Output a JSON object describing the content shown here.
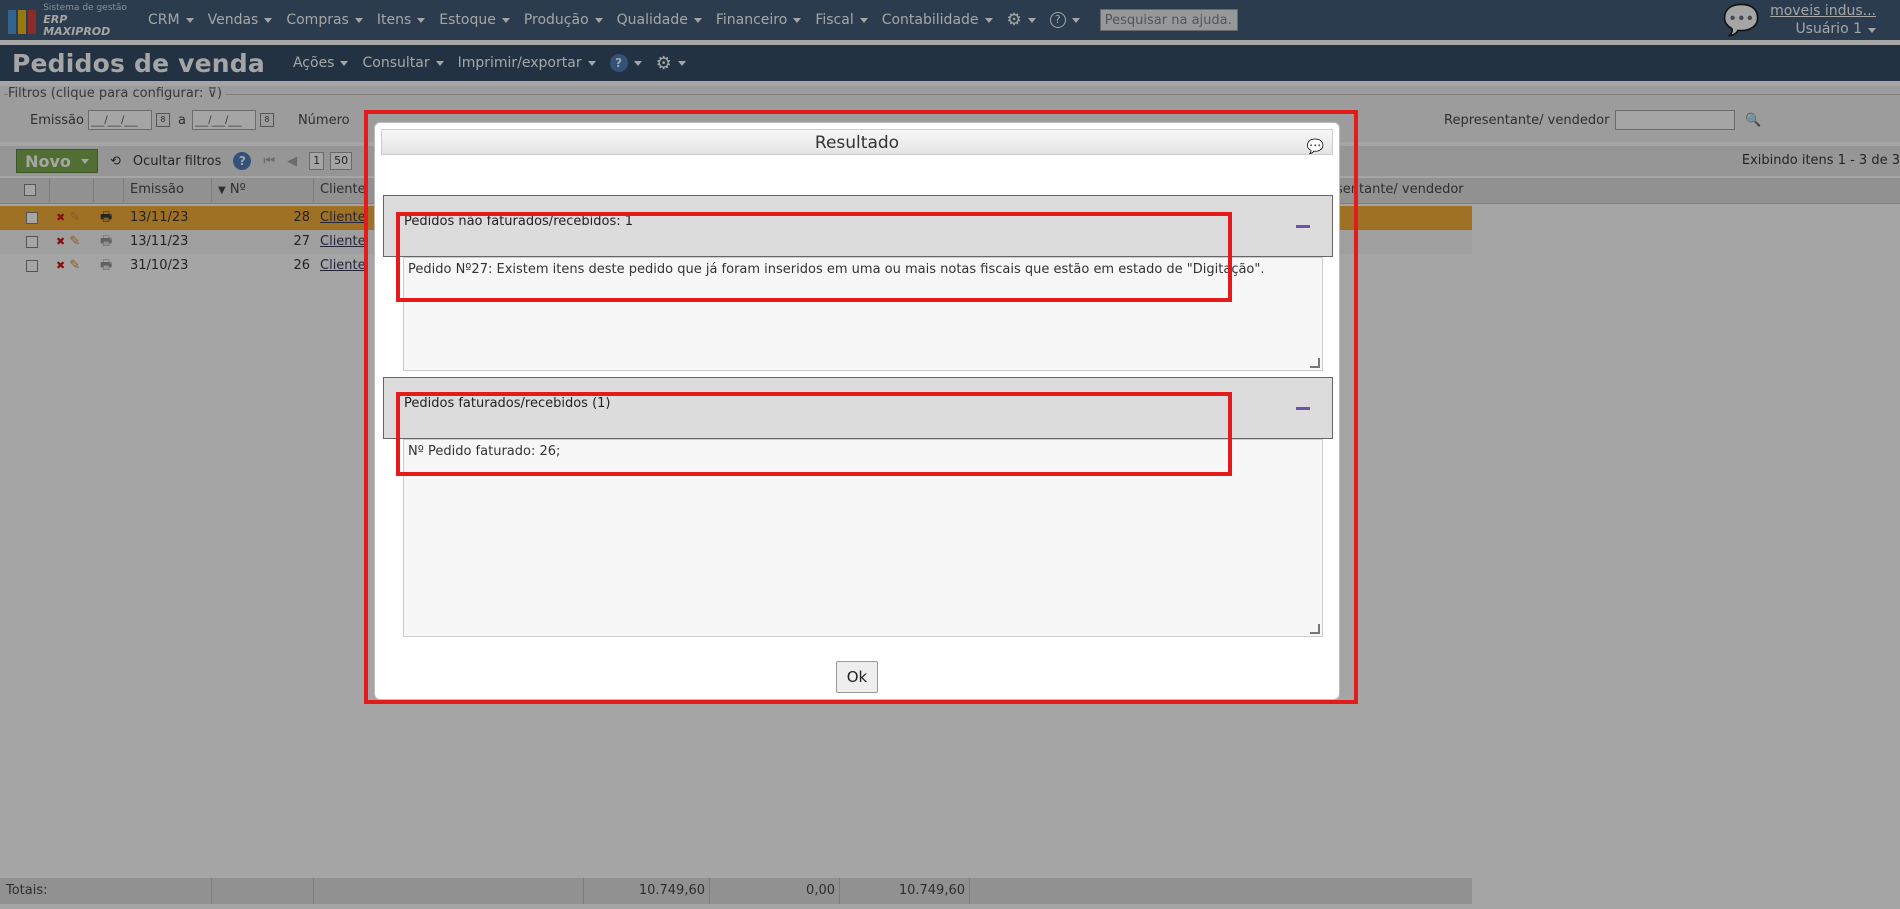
{
  "app": {
    "logo_line1": "Sistema de gestão",
    "logo_line2": "ERP MAXIPROD"
  },
  "topnav": {
    "menus": [
      "CRM",
      "Vendas",
      "Compras",
      "Itens",
      "Estoque",
      "Produção",
      "Qualidade",
      "Financeiro",
      "Fiscal",
      "Contabilidade"
    ],
    "help_search_placeholder": "Pesquisar na ajuda...",
    "company": "moveis indus...",
    "user": "Usuário 1"
  },
  "page": {
    "title": "Pedidos de venda",
    "menus": [
      "Ações",
      "Consultar",
      "Imprimir/exportar"
    ]
  },
  "filters": {
    "legend": "Filtros (clique para configurar:",
    "emissao_label": "Emissão",
    "date_from": "__/__/__",
    "date_sep": "a",
    "date_to": "__/__/__",
    "numero_label": "Número",
    "representante_label": "Representante/ vendedor"
  },
  "toolbar": {
    "novo_label": "Novo",
    "ocultar_filtros": "Ocultar filtros",
    "page_number": "1",
    "page_size": "50",
    "display_info": "Exibindo itens 1 - 3 de 3"
  },
  "grid": {
    "headers": {
      "emissao": "Emissão",
      "numero": "Nº",
      "cliente": "Cliente",
      "representante": "sentante/ vendedor"
    },
    "rows": [
      {
        "emissao": "13/11/23",
        "numero": "28",
        "cliente": "Cliente"
      },
      {
        "emissao": "13/11/23",
        "numero": "27",
        "cliente": "Cliente"
      },
      {
        "emissao": "31/10/23",
        "numero": "26",
        "cliente": "Cliente"
      }
    ],
    "totals": {
      "label": "Totais:",
      "v1": "10.749,60",
      "v2": "0,00",
      "v3": "10.749,60"
    }
  },
  "modal": {
    "title": "Resultado",
    "section1": {
      "title": "Pedidos não faturados/recebidos: 1",
      "text": "Pedido Nº27: Existem itens deste pedido que já foram inseridos em uma ou mais notas fiscais que estão em estado de \"Digitação\"."
    },
    "section2": {
      "title": "Pedidos faturados/recebidos (1)",
      "text": "Nº Pedido faturado: 26;"
    },
    "ok_label": "Ok"
  },
  "colors": {
    "nav_bg": "#2b4a68",
    "header_bg": "#1f3a55",
    "row_highlight": "#f5a623",
    "novo_green": "#6fa23c",
    "annotation_red": "#e41b1b"
  }
}
